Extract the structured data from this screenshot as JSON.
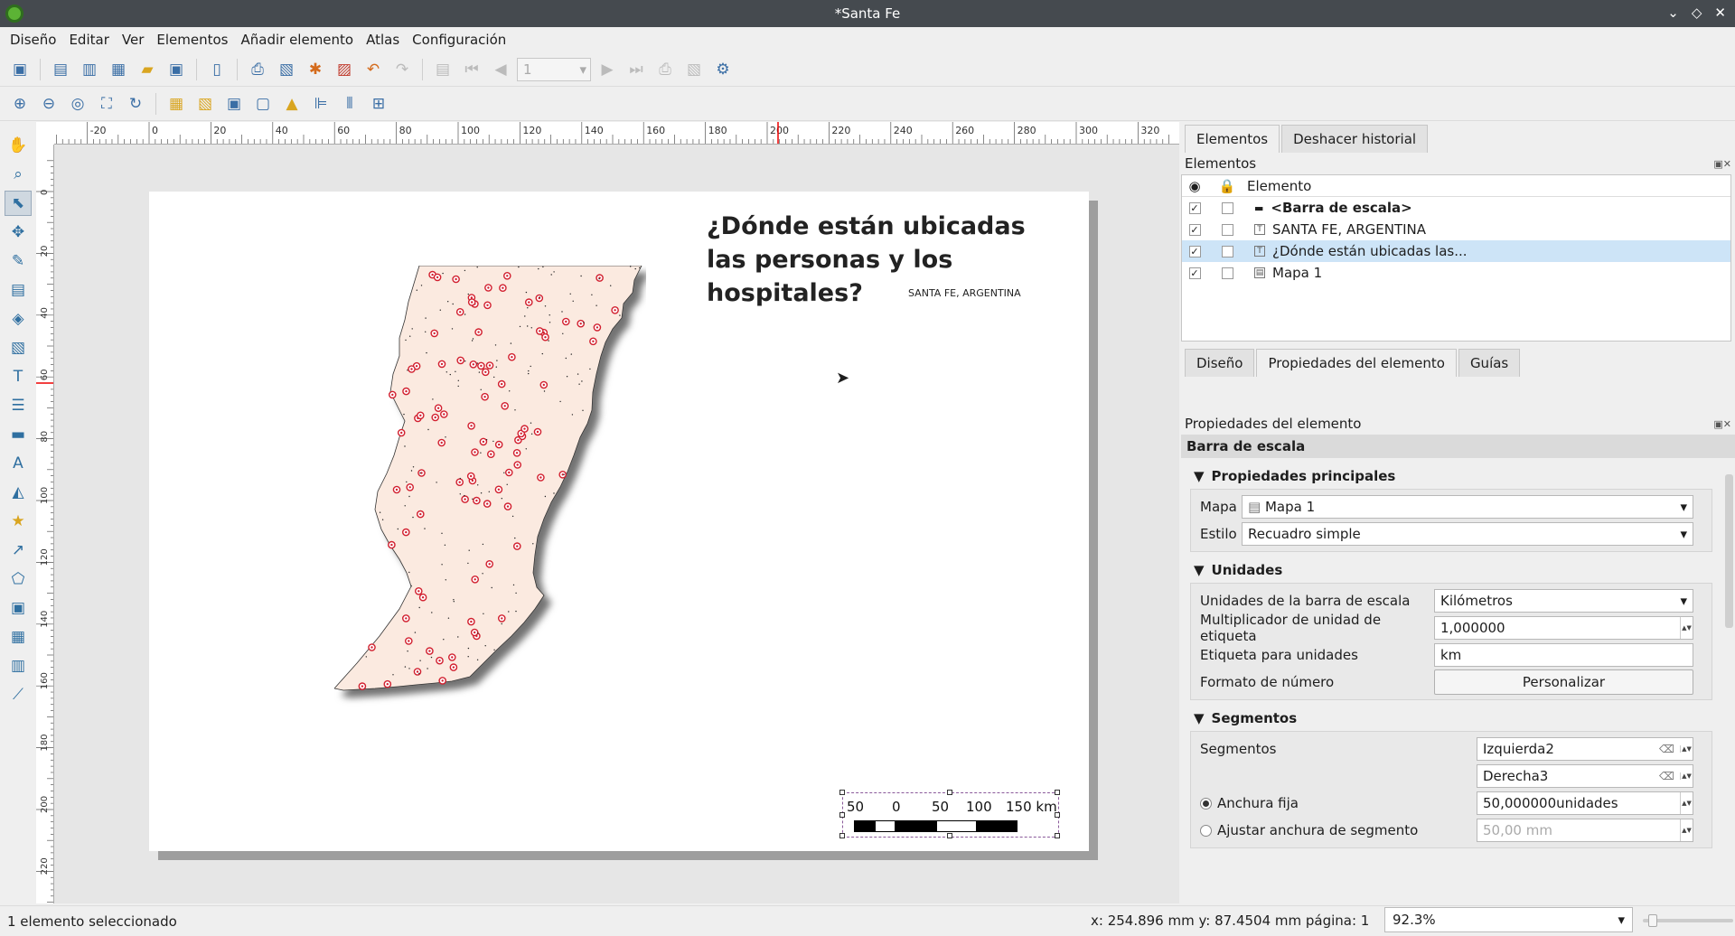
{
  "window": {
    "title": "*Santa Fe"
  },
  "menu": [
    "Diseño",
    "Editar",
    "Ver",
    "Elementos",
    "Añadir elemento",
    "Atlas",
    "Configuración"
  ],
  "toolbar": {
    "page_value": "1"
  },
  "ruler": {
    "h_ticks": [
      "-20",
      "0",
      "20",
      "40",
      "60",
      "80",
      "100",
      "120",
      "140",
      "160",
      "180",
      "200",
      "220",
      "240",
      "260",
      "280",
      "300",
      "320"
    ],
    "v_ticks": [
      "0",
      "20",
      "40",
      "60",
      "80",
      "100",
      "120",
      "140",
      "160",
      "180",
      "200",
      "220"
    ]
  },
  "layout": {
    "title": "¿Dónde están ubicadas las personas y los hospitales?",
    "subtitle": "SANTA FE, ARGENTINA",
    "scalebar_labels": [
      "50",
      "0",
      "50",
      "100",
      "150 km"
    ]
  },
  "right_panel": {
    "top_tabs": [
      "Elementos",
      "Deshacer historial"
    ],
    "items_label": "Elementos",
    "tree_header": "Elemento",
    "items": [
      {
        "name": "<Barra de escala>",
        "visible": true,
        "locked": false,
        "bold": true,
        "icon": "scalebar-icon"
      },
      {
        "name": "SANTA FE, ARGENTINA",
        "visible": true,
        "locked": false,
        "bold": false,
        "icon": "label-icon"
      },
      {
        "name": "¿Dónde están ubicadas las...",
        "visible": true,
        "locked": false,
        "bold": false,
        "icon": "label-icon"
      },
      {
        "name": "Mapa 1",
        "visible": true,
        "locked": false,
        "bold": false,
        "icon": "map-icon"
      }
    ],
    "prop_tabs": [
      "Diseño",
      "Propiedades del elemento",
      "Guías"
    ],
    "props_label": "Propiedades del elemento",
    "section_title": "Barra de escala",
    "groups": {
      "main": {
        "title": "Propiedades principales",
        "map_label": "Mapa",
        "map_value": "Mapa 1",
        "style_label": "Estilo",
        "style_value": "Recuadro simple"
      },
      "units": {
        "title": "Unidades",
        "unit_label": "Unidades de la barra de escala",
        "unit_value": "Kilómetros",
        "mult_label": "Multiplicador de unidad de etiqueta",
        "mult_value": "1,000000",
        "lbl_label": "Etiqueta para unidades",
        "lbl_value": "km",
        "fmt_label": "Formato de número",
        "fmt_button": "Personalizar"
      },
      "segments": {
        "title": "Segmentos",
        "seg_label": "Segmentos",
        "left_value": "Izquierda2",
        "right_value": "Derecha3",
        "fixed_label": "Anchura fija",
        "fixed_value": "50,000000unidades",
        "fit_label": "Ajustar anchura de segmento",
        "fit_value": "50,00 mm"
      }
    }
  },
  "status": {
    "selection": "1 elemento seleccionado",
    "coords": "x: 254.896 mm  y: 87.4504 mm  página: 1",
    "zoom": "92.3%"
  },
  "colors": {
    "titlebar": "#454a4f",
    "selection": "#cde4f7",
    "province_fill": "#fbeae0",
    "hospital_marker": "#d2202f"
  }
}
